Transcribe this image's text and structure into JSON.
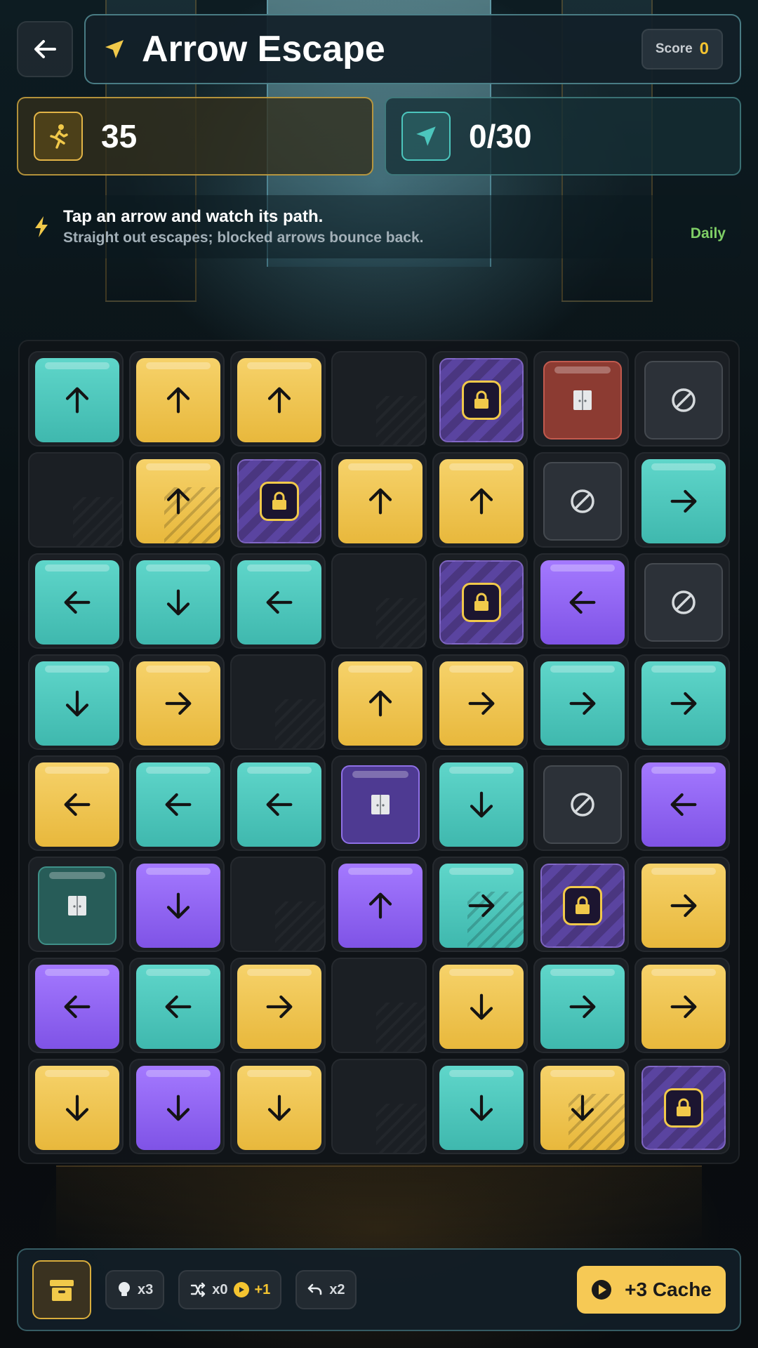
{
  "header": {
    "title": "Arrow Escape",
    "score_label": "Score",
    "score_value": "0"
  },
  "stats": {
    "moves": "35",
    "progress": "0/30"
  },
  "hint": {
    "line1": "Tap an arrow and watch its path.",
    "line2": "Straight out escapes; blocked arrows bounce back.",
    "tag": "Daily"
  },
  "colors": {
    "teal": "#4fc7bc",
    "yellow": "#efc450",
    "purple": "#9166f2",
    "accent_gold": "#f4c430"
  },
  "board": {
    "rows": 8,
    "cols": 7,
    "cells": [
      [
        {
          "t": "teal",
          "d": "up"
        },
        {
          "t": "yellow",
          "d": "up"
        },
        {
          "t": "yellow",
          "d": "up"
        },
        {
          "t": "empty"
        },
        {
          "t": "locked"
        },
        {
          "t": "door-red"
        },
        {
          "t": "wall"
        }
      ],
      [
        {
          "t": "empty"
        },
        {
          "t": "yellow",
          "d": "up",
          "s": true
        },
        {
          "t": "locked"
        },
        {
          "t": "yellow",
          "d": "up"
        },
        {
          "t": "yellow",
          "d": "up"
        },
        {
          "t": "wall"
        },
        {
          "t": "teal",
          "d": "right"
        }
      ],
      [
        {
          "t": "teal",
          "d": "left"
        },
        {
          "t": "teal",
          "d": "down"
        },
        {
          "t": "teal",
          "d": "left"
        },
        {
          "t": "empty"
        },
        {
          "t": "locked"
        },
        {
          "t": "purple",
          "d": "left"
        },
        {
          "t": "wall"
        }
      ],
      [
        {
          "t": "teal",
          "d": "down"
        },
        {
          "t": "yellow",
          "d": "right"
        },
        {
          "t": "empty"
        },
        {
          "t": "yellow",
          "d": "up"
        },
        {
          "t": "yellow",
          "d": "right"
        },
        {
          "t": "teal",
          "d": "right"
        },
        {
          "t": "teal",
          "d": "right"
        }
      ],
      [
        {
          "t": "yellow",
          "d": "left"
        },
        {
          "t": "teal",
          "d": "left"
        },
        {
          "t": "teal",
          "d": "left"
        },
        {
          "t": "door-purple"
        },
        {
          "t": "teal",
          "d": "down"
        },
        {
          "t": "wall"
        },
        {
          "t": "purple",
          "d": "left"
        }
      ],
      [
        {
          "t": "door-teal"
        },
        {
          "t": "purple",
          "d": "down"
        },
        {
          "t": "empty"
        },
        {
          "t": "purple",
          "d": "up"
        },
        {
          "t": "teal",
          "d": "right",
          "s": true
        },
        {
          "t": "locked"
        },
        {
          "t": "yellow",
          "d": "right"
        }
      ],
      [
        {
          "t": "purple",
          "d": "left"
        },
        {
          "t": "teal",
          "d": "left"
        },
        {
          "t": "yellow",
          "d": "right"
        },
        {
          "t": "empty"
        },
        {
          "t": "yellow",
          "d": "down"
        },
        {
          "t": "teal",
          "d": "right"
        },
        {
          "t": "yellow",
          "d": "right"
        }
      ],
      [
        {
          "t": "yellow",
          "d": "down"
        },
        {
          "t": "purple",
          "d": "down"
        },
        {
          "t": "yellow",
          "d": "down"
        },
        {
          "t": "empty"
        },
        {
          "t": "teal",
          "d": "down"
        },
        {
          "t": "yellow",
          "d": "down",
          "s": true
        },
        {
          "t": "locked"
        }
      ]
    ]
  },
  "toolbar": {
    "hint_count": "x3",
    "shuffle_count": "x0",
    "shuffle_bonus": "+1",
    "undo_count": "x2",
    "cache_label": "+3 Cache"
  },
  "icons": {
    "back": "arrow-left-icon",
    "title": "navigation-arrow-icon",
    "moves": "running-person-icon",
    "progress": "navigation-arrow-icon",
    "hint": "lightning-icon",
    "cache_box": "archive-box-icon",
    "hint_tool": "lightbulb-icon",
    "shuffle_tool": "shuffle-icon",
    "undo_tool": "undo-icon",
    "play": "play-icon"
  }
}
